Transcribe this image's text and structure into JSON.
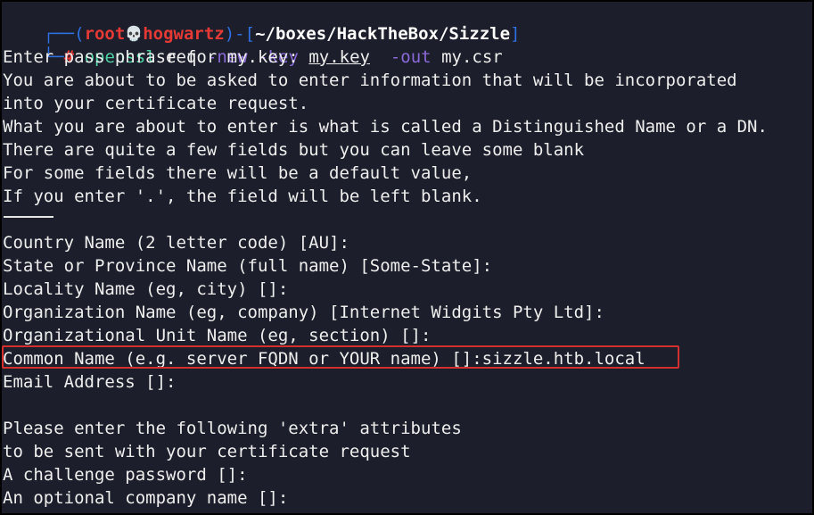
{
  "prompt": {
    "corner_top": "┌──(",
    "user": "root",
    "skull_icon": "💀",
    "host": "hogwartz",
    "sep": ")-[",
    "path": "~/boxes/HackTheBox/Sizzle",
    "close": "]",
    "corner_bottom": "└─",
    "hash": "#",
    "cmd_name": "openssl",
    "cmd_sub": "req",
    "flag_new": "-new",
    "flag_key": "-key",
    "key_file": "my.key",
    "flag_out": "-out",
    "out_file": "my.csr"
  },
  "output": {
    "l1": "Enter pass phrase for my.key:",
    "l2": "You are about to be asked to enter information that will be incorporated",
    "l3": "into your certificate request.",
    "l4": "What you are about to enter is what is called a Distinguished Name or a DN.",
    "l5": "There are quite a few fields but you can leave some blank",
    "l6": "For some fields there will be a default value,",
    "l7": "If you enter '.', the field will be left blank.",
    "l8": "Country Name (2 letter code) [AU]:",
    "l9": "State or Province Name (full name) [Some-State]:",
    "l10": "Locality Name (eg, city) []:",
    "l11": "Organization Name (eg, company) [Internet Widgits Pty Ltd]:",
    "l12": "Organizational Unit Name (eg, section) []:",
    "l13": "Common Name (e.g. server FQDN or YOUR name) []:sizzle.htb.local",
    "l14": "Email Address []:",
    "l15": "Please enter the following 'extra' attributes",
    "l16": "to be sent with your certificate request",
    "l17": "A challenge password []:",
    "l18": "An optional company name []:"
  },
  "colors": {
    "background": "#1c1f2b",
    "prompt_frame": "#2f6fe0",
    "user_host": "#e53935",
    "command": "#4fd1a5",
    "flags": "#8a6ad8",
    "highlight_border": "#d32f2f"
  }
}
